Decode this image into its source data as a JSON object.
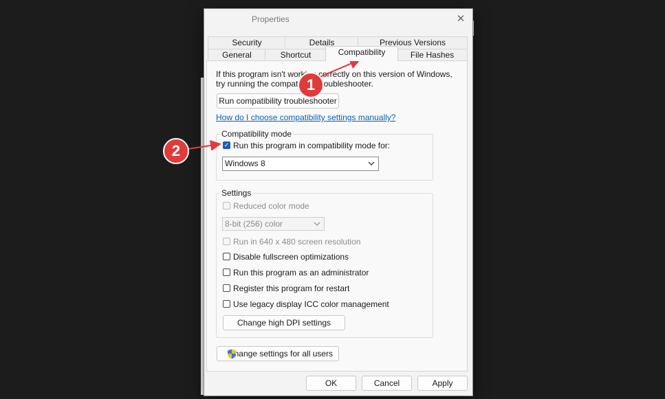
{
  "dialog": {
    "title": "Properties",
    "close_glyph": "✕"
  },
  "tabs": {
    "row1": [
      "Security",
      "Details",
      "Previous Versions"
    ],
    "row2": [
      "General",
      "Shortcut",
      "Compatibility",
      "File Hashes"
    ],
    "active": "Compatibility"
  },
  "compat": {
    "intro_line1": "If this program isn't working correctly on this version of Windows,",
    "intro_line2": "try running the compatibility troubleshooter.",
    "troubleshooter_button": "Run compatibility troubleshooter",
    "manual_link": "How do I choose compatibility settings manually?",
    "mode_group_label": "Compatibility mode",
    "mode_checkbox_label": "Run this program in compatibility mode for:",
    "mode_checked": true,
    "mode_select_value": "Windows 8"
  },
  "settings": {
    "group_label": "Settings",
    "reduced_color_label": "Reduced color mode",
    "color_select_value": "8-bit (256) color",
    "res640_label": "Run in 640 x 480 screen resolution",
    "fullscreen_label": "Disable fullscreen optimizations",
    "admin_label": "Run this program as an administrator",
    "restart_label": "Register this program for restart",
    "icc_label": "Use legacy display ICC color management",
    "dpi_button": "Change high DPI settings"
  },
  "all_users_button": "Change settings for all users",
  "footer": {
    "ok": "OK",
    "cancel": "Cancel",
    "apply": "Apply"
  },
  "annotations": {
    "badge1": "1",
    "badge2": "2",
    "color": "#e03b3b"
  },
  "icons": [
    "close-icon",
    "checkmark-icon",
    "chevron-down-icon",
    "uac-shield-icon"
  ]
}
